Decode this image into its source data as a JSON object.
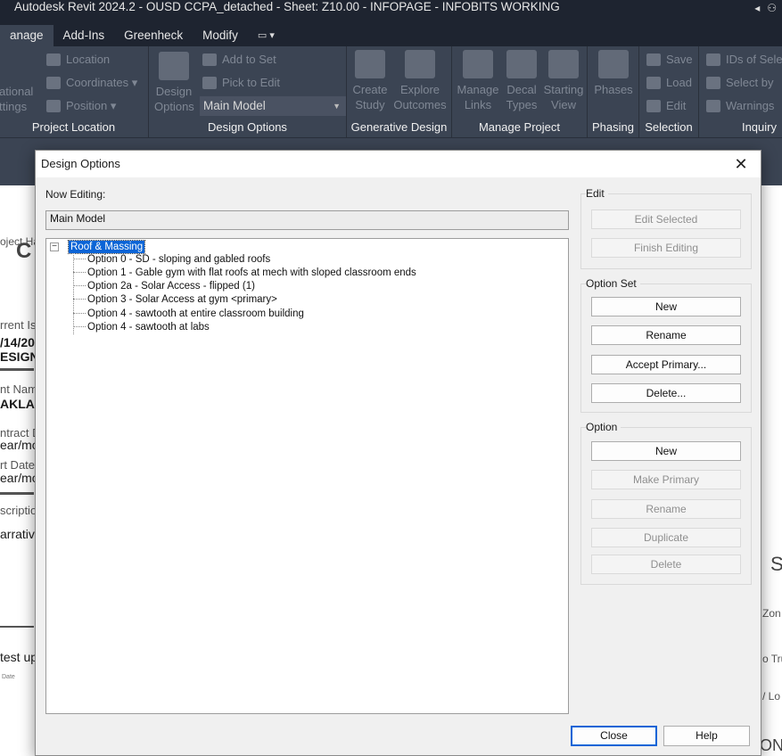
{
  "window": {
    "title": "Autodesk Revit 2024.2 - OUSD CCPA_detached - Sheet: Z10.00 - INFOPAGE - INFOBITS WORKING"
  },
  "ribbon_tabs": [
    "anage",
    "Add-Ins",
    "Greenheck",
    "Modify",
    "▭ ▾"
  ],
  "ribbon": {
    "panels": {
      "project_location": {
        "label": "Project Location",
        "left_cut": "ational\nttings",
        "items": [
          "Location",
          "Coordinates ▾",
          "Position ▾"
        ]
      },
      "design_options": {
        "label": "Design Options",
        "big": "Design\nOptions",
        "items": [
          "Add to Set",
          "Pick to Edit"
        ],
        "combo": "Main Model"
      },
      "generative_design": {
        "label": "Generative Design",
        "big": [
          "Create\nStudy",
          "Explore\nOutcomes"
        ]
      },
      "manage_project": {
        "label": "Manage Project",
        "big": [
          "Manage\nLinks",
          "Decal\nTypes",
          "Starting\nView"
        ]
      },
      "phasing": {
        "label": "Phasing",
        "big": "Phases"
      },
      "selection": {
        "label": "Selection",
        "items": [
          "Save",
          "Load",
          "Edit"
        ]
      },
      "inquiry": {
        "label": "Inquiry",
        "items": [
          "IDs of Sele",
          "Select by",
          "Warnings"
        ]
      }
    }
  },
  "background_sheet": {
    "texts": [
      "oject Ha",
      "C",
      "rrent Is",
      "/14/20",
      "ESIGN",
      "nt Nam",
      "AKLAN",
      "ntract D",
      "ear/mo",
      "rt Date",
      "ear/mo",
      "scriptio",
      "arrativ",
      "test up",
      "Date",
      "S",
      "Zon",
      "o Tru",
      "/ Lo",
      "ON"
    ]
  },
  "dialog": {
    "title": "Design Options",
    "now_editing_label": "Now Editing:",
    "now_editing_value": "Main Model",
    "tree": {
      "root": "Roof & Massing",
      "expander": "−",
      "items": [
        "Option 0 - SD - sloping and gabled roofs",
        "Option 1 - Gable gym with flat roofs at mech with sloped classroom ends",
        "Option 2a - Solar Access - flipped (1)",
        "Option 3 - Solar Access at gym  <primary>",
        "Option 4 - sawtooth at entire classroom building",
        "Option 4 - sawtooth at labs"
      ]
    },
    "edit_group": {
      "title": "Edit",
      "buttons": [
        "Edit Selected",
        "Finish Editing"
      ]
    },
    "option_set_group": {
      "title": "Option Set",
      "buttons": [
        "New",
        "Rename",
        "Accept Primary...",
        "Delete..."
      ]
    },
    "option_group": {
      "title": "Option",
      "buttons": [
        "New",
        "Make Primary",
        "Rename",
        "Duplicate",
        "Delete"
      ]
    },
    "close_button": "Close",
    "help_button": "Help",
    "close_glyph": "✕"
  }
}
